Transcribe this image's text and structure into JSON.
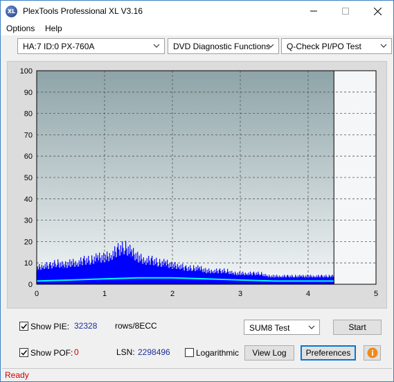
{
  "window": {
    "title": "PlexTools Professional XL V3.16",
    "app_icon_text": "XL"
  },
  "menu": {
    "options_label": "Options",
    "help_label": "Help"
  },
  "toolbar": {
    "drive": "HA:7 ID:0  PX-760A",
    "function": "DVD Diagnostic Functions",
    "test": "Q-Check PI/PO Test"
  },
  "chart_data": {
    "type": "area",
    "xlim": [
      0,
      5
    ],
    "ylim": [
      0,
      100
    ],
    "x_ticks": [
      "0",
      "1",
      "2",
      "3",
      "4",
      "5"
    ],
    "y_ticks": [
      "0",
      "10",
      "20",
      "30",
      "40",
      "50",
      "60",
      "70",
      "80",
      "90",
      "100"
    ],
    "grid": true,
    "end_marker_x": 4.38,
    "series": [
      {
        "color": "#0000ff",
        "x": [
          0.0,
          0.1,
          0.2,
          0.3,
          0.4,
          0.5,
          0.6,
          0.7,
          0.8,
          0.9,
          1.0,
          1.1,
          1.2,
          1.3,
          1.4,
          1.5,
          1.6,
          1.7,
          1.8,
          1.9,
          2.0,
          2.1,
          2.2,
          2.3,
          2.4,
          2.5,
          2.6,
          2.7,
          2.8,
          2.9,
          3.0,
          3.1,
          3.2,
          3.3,
          3.4,
          3.5,
          3.6,
          3.7,
          3.8,
          3.9,
          4.0,
          4.1,
          4.2,
          4.3,
          4.38
        ],
        "values": [
          6,
          7,
          7,
          8,
          7,
          8,
          8,
          9,
          9,
          10,
          10,
          11,
          13,
          14,
          12,
          10,
          9,
          9,
          8,
          8,
          7,
          7,
          6,
          6,
          6,
          5,
          5,
          5,
          5,
          4,
          4,
          4,
          4,
          4,
          3,
          3,
          3,
          3,
          3,
          3,
          3,
          3,
          3,
          3,
          3
        ]
      },
      {
        "color": "#00ffff",
        "x": [
          0.0,
          0.5,
          1.0,
          1.5,
          2.0,
          2.5,
          3.0,
          3.5,
          4.0,
          4.38
        ],
        "values": [
          1.5,
          2,
          2.5,
          3,
          3,
          2.5,
          2,
          1.5,
          1.5,
          1.5
        ]
      }
    ]
  },
  "controls": {
    "show_pie_label": "Show PIE:",
    "pie_value": "32328",
    "rows_label": "rows/8ECC",
    "show_pof_label": "Show POF:",
    "pof_value": "0",
    "lsn_label": "LSN:",
    "lsn_value": "2298496",
    "logarithmic_label": "Logarithmic",
    "sum_test": "SUM8 Test",
    "start_label": "Start",
    "view_log_label": "View Log",
    "preferences_label": "Preferences"
  },
  "status": {
    "text": "Ready"
  }
}
